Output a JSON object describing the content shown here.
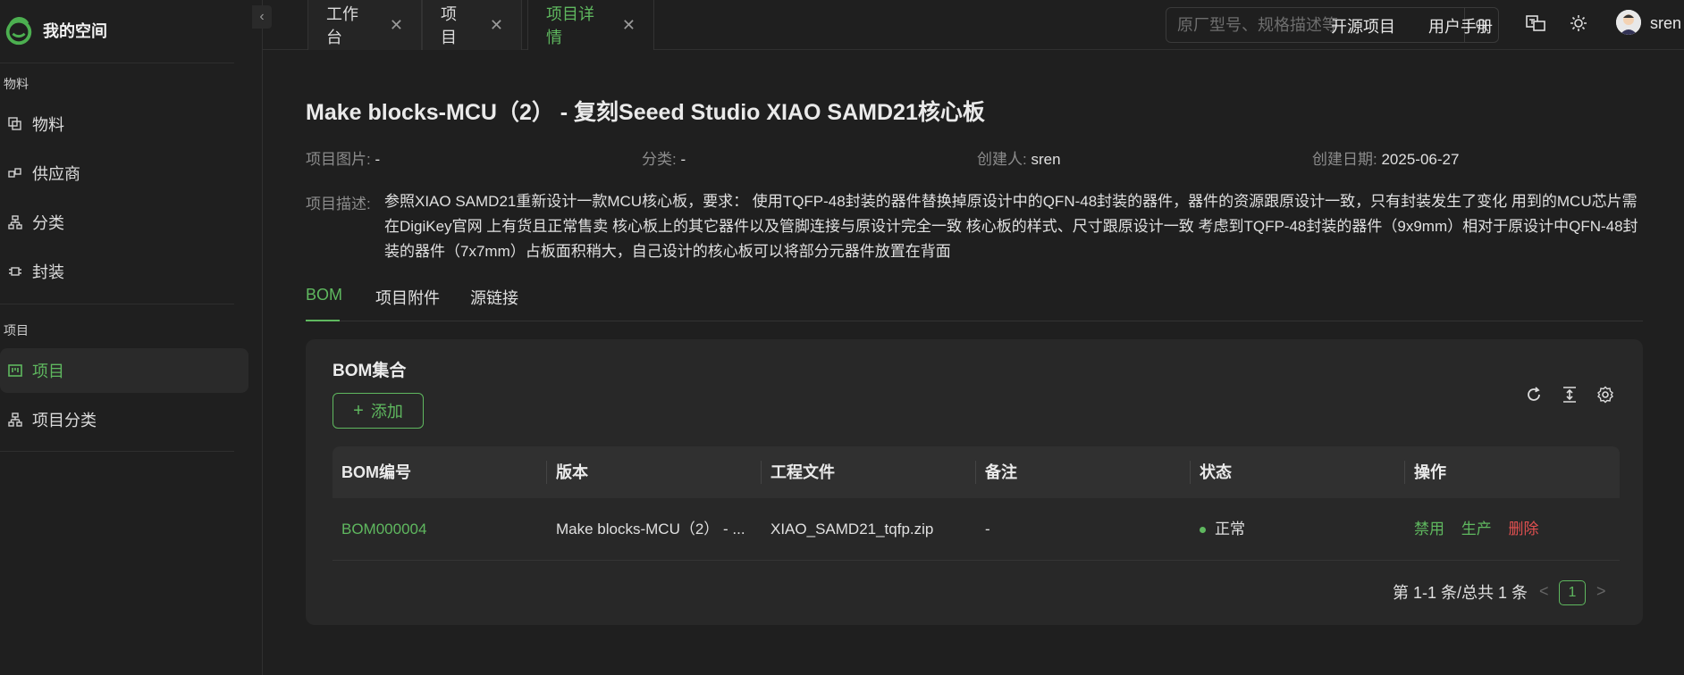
{
  "sidebar": {
    "logo_text": "我的空间",
    "collapse": "‹",
    "groups": [
      {
        "label": "物料"
      },
      {
        "label": "项目"
      }
    ],
    "items": [
      {
        "label": "物料",
        "icon": "copy-icon"
      },
      {
        "label": "供应商",
        "icon": "supplier-icon"
      },
      {
        "label": "分类",
        "icon": "tree-icon"
      },
      {
        "label": "封装",
        "icon": "package-icon"
      },
      {
        "label": "项目",
        "icon": "project-icon",
        "active": true
      },
      {
        "label": "项目分类",
        "icon": "tree-icon"
      }
    ]
  },
  "tabs": [
    {
      "label": "工作台"
    },
    {
      "label": "项目"
    },
    {
      "label": "项目详情",
      "active": true
    }
  ],
  "search": {
    "placeholder": "原厂型号、规格描述等"
  },
  "header": {
    "open_source": "开源项目",
    "manual": "用户手册",
    "username": "sren"
  },
  "project": {
    "title": "Make blocks-MCU（2） - 复刻Seeed Studio XIAO SAMD21核心板",
    "image_label": "项目图片:",
    "image_value": "-",
    "category_label": "分类:",
    "category_value": "-",
    "creator_label": "创建人:",
    "creator_value": "sren",
    "date_label": "创建日期:",
    "date_value": "2025-06-27",
    "desc_label": "项目描述:",
    "desc_value": "参照XIAO SAMD21重新设计一款MCU核心板，要求： 使用TQFP-48封装的器件替换掉原设计中的QFN-48封装的器件，器件的资源跟原设计一致，只有封装发生了变化 用到的MCU芯片需在DigiKey官网 上有货且正常售卖 核心板上的其它器件以及管脚连接与原设计完全一致 核心板的样式、尺寸跟原设计一致 考虑到TQFP-48封装的器件（9x9mm）相对于原设计中QFN-48封装的器件（7x7mm）占板面积稍大，自己设计的核心板可以将部分元器件放置在背面"
  },
  "subtabs": [
    {
      "label": "BOM",
      "active": true
    },
    {
      "label": "项目附件"
    },
    {
      "label": "源链接"
    }
  ],
  "bom": {
    "title": "BOM集合",
    "add_label": "添加",
    "columns": [
      "BOM编号",
      "版本",
      "工程文件",
      "备注",
      "状态",
      "操作"
    ],
    "rows": [
      {
        "id": "BOM000004",
        "version": "Make blocks-MCU（2） - ...",
        "file": "XIAO_SAMD21_tqfp.zip",
        "note": "-",
        "status": "正常",
        "actions": [
          "禁用",
          "生产",
          "删除"
        ]
      }
    ],
    "pager_text": "第 1-1 条/总共 1 条",
    "current_page": "1",
    "prev": "<",
    "next": ">"
  },
  "colors": {
    "accent": "#5fb85f",
    "danger": "#e05050",
    "bg": "#1f1f1f",
    "card": "#282828"
  }
}
